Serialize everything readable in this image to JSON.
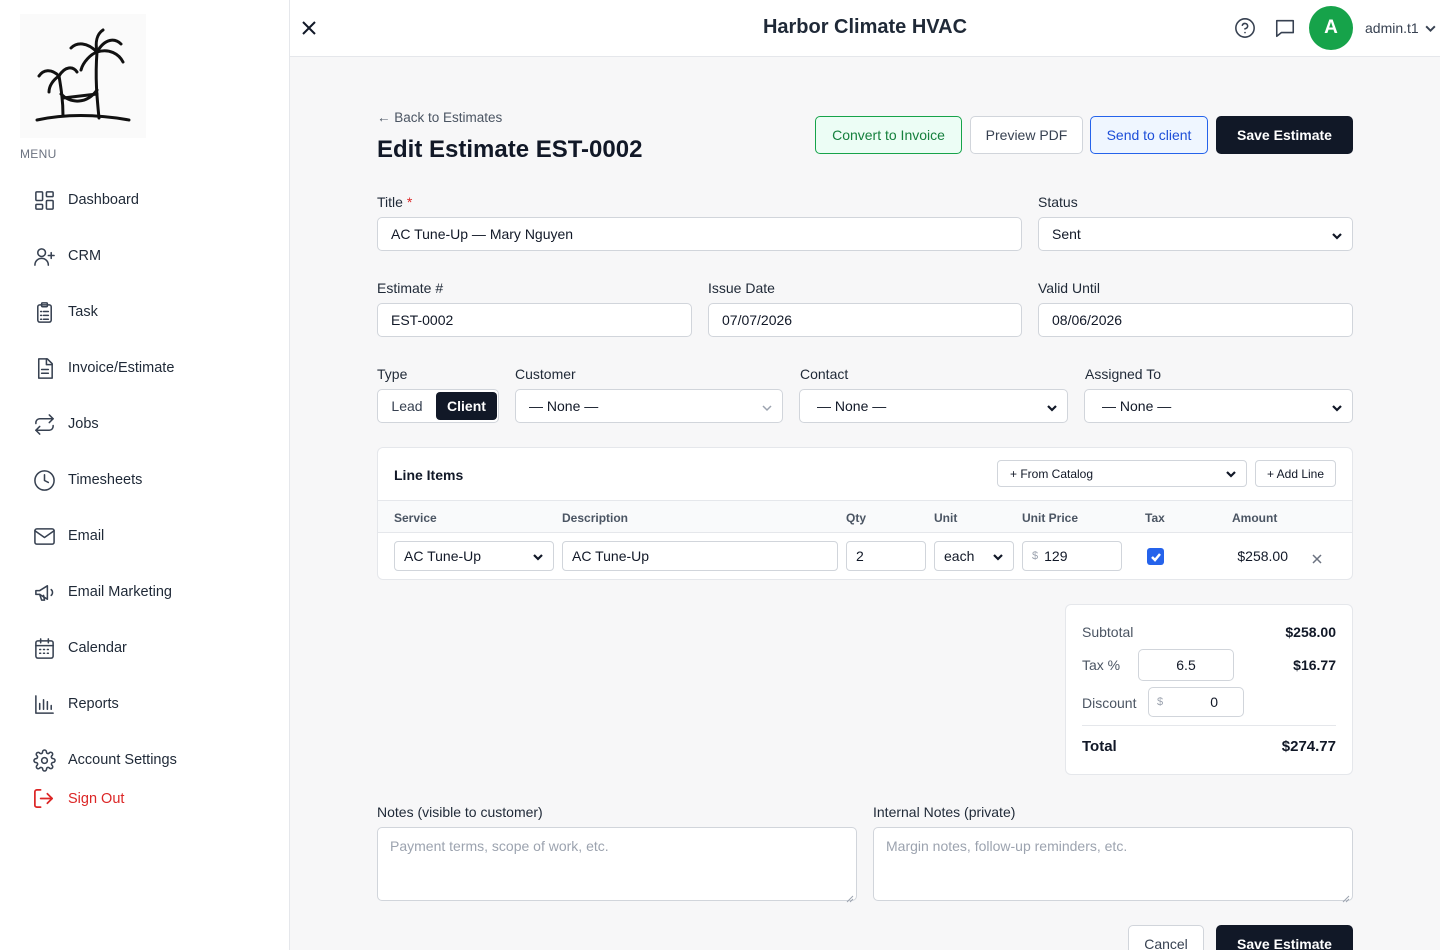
{
  "app": {
    "title": "Harbor Climate HVAC"
  },
  "user": {
    "initial": "A",
    "name": "admin.t1"
  },
  "sidebar": {
    "menu_label": "MENU",
    "items": [
      {
        "label": "Dashboard",
        "icon": "dashboard-icon"
      },
      {
        "label": "CRM",
        "icon": "user-plus-icon"
      },
      {
        "label": "Task",
        "icon": "clipboard-icon"
      },
      {
        "label": "Invoice/Estimate",
        "icon": "document-icon"
      },
      {
        "label": "Jobs",
        "icon": "repeat-icon"
      },
      {
        "label": "Timesheets",
        "icon": "clock-icon"
      },
      {
        "label": "Email",
        "icon": "mail-icon"
      },
      {
        "label": "Email Marketing",
        "icon": "megaphone-icon"
      },
      {
        "label": "Calendar",
        "icon": "calendar-icon"
      },
      {
        "label": "Reports",
        "icon": "bar-chart-icon"
      },
      {
        "label": "Account Settings",
        "icon": "gear-icon"
      }
    ],
    "sign_out": "Sign Out"
  },
  "page": {
    "back_link": "← Back to Estimates",
    "title": "Edit Estimate EST-0002",
    "actions": {
      "convert": "Convert to Invoice",
      "preview": "Preview PDF",
      "send": "Send to client",
      "save": "Save Estimate"
    }
  },
  "form": {
    "title_label": "Title",
    "title_required": "*",
    "title_value": "AC Tune-Up — Mary Nguyen",
    "status_label": "Status",
    "status_value": "Sent",
    "estimate_no_label": "Estimate #",
    "estimate_no_value": "EST-0002",
    "issue_date_label": "Issue Date",
    "issue_date_value": "07/07/2026",
    "valid_until_label": "Valid Until",
    "valid_until_value": "08/06/2026",
    "type_label": "Type",
    "type_options": [
      "Lead",
      "Client"
    ],
    "type_selected": "Client",
    "customer_label": "Customer",
    "customer_value": "— None —",
    "contact_label": "Contact",
    "contact_value": "— None —",
    "assigned_label": "Assigned To",
    "assigned_value": "— None —"
  },
  "line_items": {
    "title": "Line Items",
    "from_catalog": "+ From Catalog",
    "add_line": "+ Add Line",
    "columns": [
      "Service",
      "Description",
      "Qty",
      "Unit",
      "Unit Price",
      "Tax",
      "Amount"
    ],
    "rows": [
      {
        "service": "AC Tune-Up",
        "description": "AC Tune-Up",
        "qty": "2",
        "unit": "each",
        "currency": "$",
        "unit_price": "129",
        "tax": true,
        "amount": "$258.00"
      }
    ]
  },
  "totals": {
    "subtotal_label": "Subtotal",
    "subtotal_value": "$258.00",
    "tax_label": "Tax %",
    "tax_rate": "6.5",
    "tax_value": "$16.77",
    "discount_label": "Discount",
    "discount_currency": "$",
    "discount_value": "0",
    "total_label": "Total",
    "total_value": "$274.77"
  },
  "notes": {
    "public_label": "Notes (visible to customer)",
    "public_placeholder": "Payment terms, scope of work, etc.",
    "internal_label": "Internal Notes (private)",
    "internal_placeholder": "Margin notes, follow-up reminders, etc."
  },
  "footer": {
    "cancel": "Cancel",
    "save": "Save Estimate"
  },
  "colors": {
    "accent_dark": "#111827",
    "success": "#16a34a",
    "primary": "#2563eb",
    "danger": "#dc2626"
  }
}
